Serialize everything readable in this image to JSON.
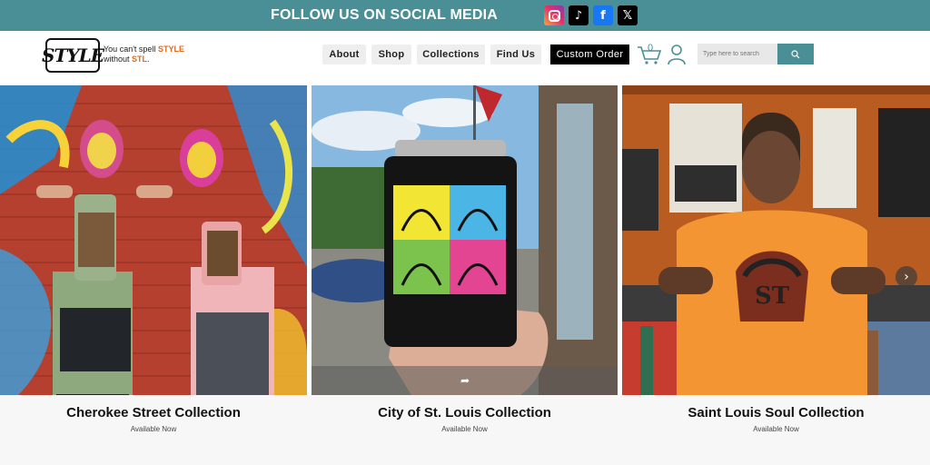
{
  "banner": {
    "title": "FOLLOW US ON SOCIAL MEDIA",
    "icons": [
      "instagram-icon",
      "tiktok-icon",
      "facebook-icon",
      "x-icon"
    ]
  },
  "header": {
    "logo_text": "STYLE",
    "tagline": {
      "line1_prefix": "You can't spell ",
      "line1_accent": "STYLE",
      "line2_prefix": "without ",
      "line2_accent": "STL",
      "line2_suffix": "."
    },
    "nav": {
      "about": "About",
      "shop": "Shop",
      "collections": "Collections",
      "find_us": "Find Us",
      "custom_order": "Custom Order"
    },
    "cart_count": "0",
    "search": {
      "placeholder": "Type here to search"
    }
  },
  "collections": [
    {
      "title": "Cherokee Street Collection",
      "subtitle": "Available Now"
    },
    {
      "title": "City of St. Louis Collection",
      "subtitle": "Available Now"
    },
    {
      "title": "Saint Louis Soul Collection",
      "subtitle": "Available Now"
    }
  ],
  "colors": {
    "banner_bg": "#4a8f96",
    "accent_orange": "#e06a1b",
    "custom_order_bg": "#000000"
  }
}
